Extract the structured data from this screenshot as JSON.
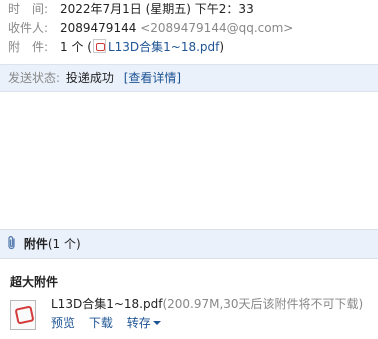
{
  "header": {
    "time_label": "时　间:",
    "time_value": "2022年7月1日 (星期五) 下午2：33",
    "recipient_label": "收件人:",
    "recipient_name": "2089479144",
    "recipient_email": "<2089479144@qq.com>",
    "attachment_label": "附　件:",
    "attachment_count": "1 个 (",
    "attachment_file": "L13D合集1~18.pdf",
    "attachment_close": ")"
  },
  "status": {
    "label": "发送状态:",
    "value": "投递成功",
    "detail_link": "[查看详情]"
  },
  "attachments": {
    "title": "附件",
    "count": "(1 个)",
    "big_attach_title": "超大附件",
    "file": {
      "name": "L13D合集1~18.pdf",
      "info": "(200.97M,30天后该附件将不可下载)",
      "actions": [
        "预览",
        "下载",
        "转存"
      ]
    }
  },
  "icons": {
    "pdf": "pdf-file-icon",
    "clip": "paperclip-icon"
  },
  "colors": {
    "link": "#1e5494",
    "muted": "#888888",
    "band": "#eaf1fb",
    "pdf_red": "#d43c3c"
  }
}
